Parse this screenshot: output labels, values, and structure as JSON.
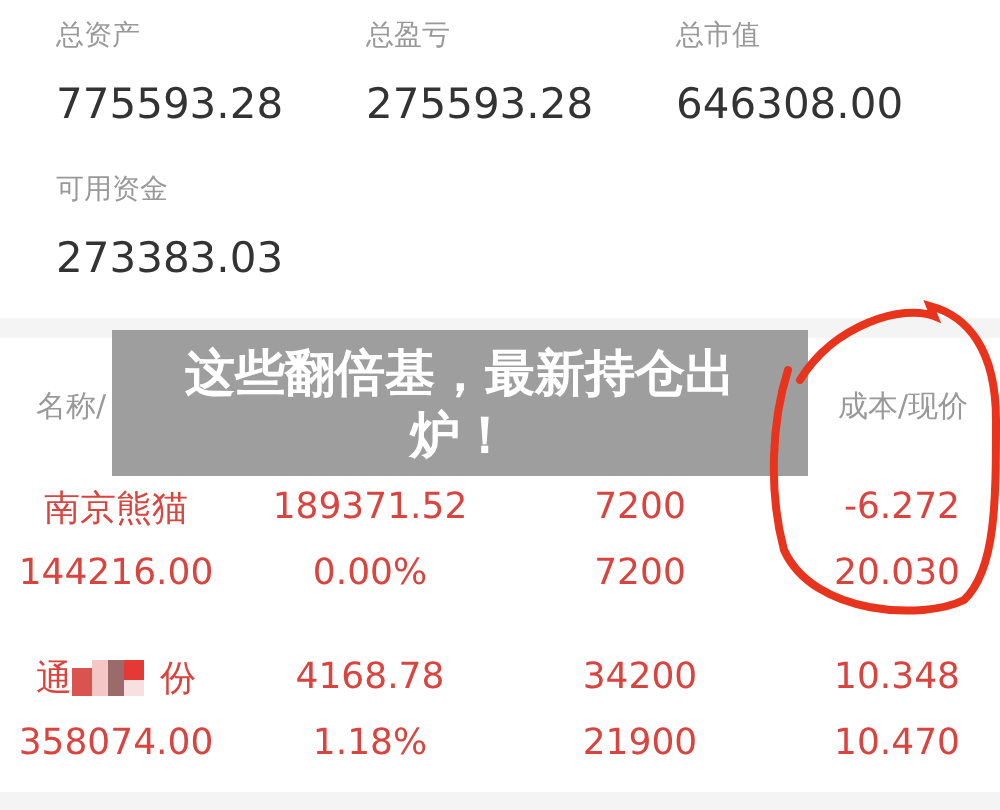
{
  "summary": [
    {
      "label": "总资产",
      "value": "775593.28"
    },
    {
      "label": "总盈亏",
      "value": "275593.28"
    },
    {
      "label": "总市值",
      "value": "646308.00"
    },
    {
      "label": "可用资金",
      "value": "273383.03"
    }
  ],
  "table": {
    "column_1": "名称/",
    "column_4": "成本/现价",
    "rows": [
      {
        "name": "南京熊猫",
        "masked": false,
        "market_value": "144216.00",
        "profit": "189371.52",
        "ratio": "0.00%",
        "holding": "7200",
        "available": "7200",
        "cost": "-6.272",
        "price": "20.030"
      },
      {
        "name": "通",
        "name_end": "份",
        "masked": true,
        "market_value": "358074.00",
        "profit": "4168.78",
        "ratio": "1.18%",
        "holding": "34200",
        "available": "21900",
        "cost": "10.348",
        "price": "10.470"
      }
    ]
  },
  "banner": {
    "title": "这些翻倍基，最新持仓出炉！"
  }
}
